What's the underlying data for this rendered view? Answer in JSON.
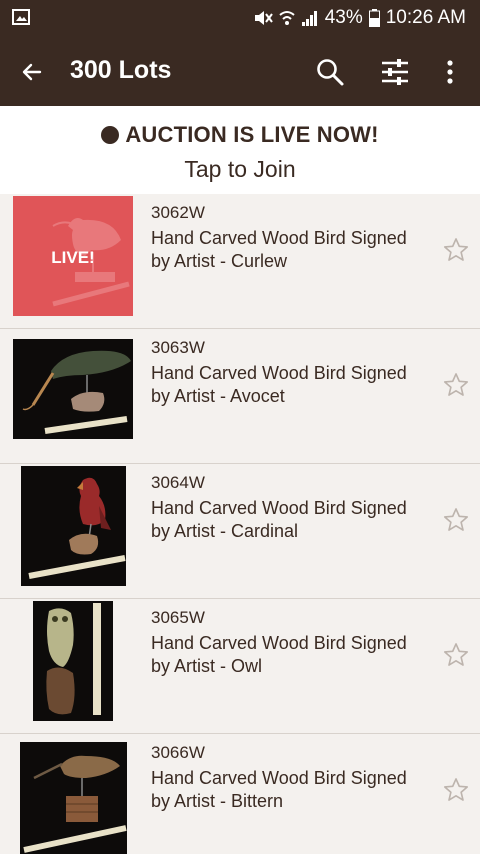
{
  "status_bar": {
    "battery": "43%",
    "time": "10:26 AM"
  },
  "app_bar": {
    "title": "300 Lots"
  },
  "banner": {
    "live_text": "AUCTION IS LIVE NOW!",
    "join_text": "Tap to Join"
  },
  "lots": [
    {
      "number": "3062W",
      "title": "Hand Carved Wood Bird Signed by Artist - Curlew",
      "badge": "LIVE!"
    },
    {
      "number": "3063W",
      "title": "Hand Carved Wood Bird Signed by Artist - Avocet"
    },
    {
      "number": "3064W",
      "title": "Hand Carved Wood Bird Signed by Artist - Cardinal"
    },
    {
      "number": "3065W",
      "title": "Hand Carved Wood Bird Signed by Artist - Owl"
    },
    {
      "number": "3066W",
      "title": "Hand Carved Wood Bird Signed by Artist - Bittern"
    }
  ],
  "colors": {
    "bar": "#3a2a22",
    "live_tile": "#e05558",
    "list_bg": "#f4f1ee"
  }
}
